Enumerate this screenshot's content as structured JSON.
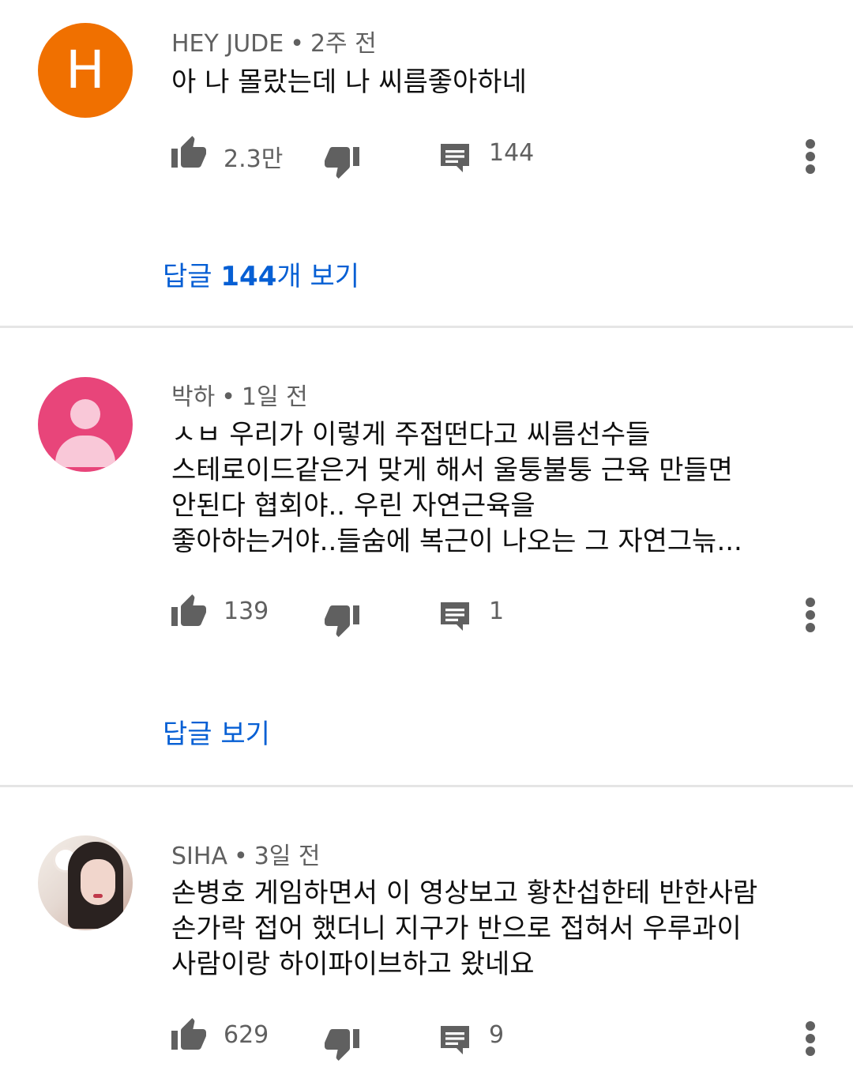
{
  "comments": [
    {
      "author": "HEY JUDE",
      "separator": "•",
      "time": "2주 전",
      "avatar_letter": "H",
      "text": "아 나 몰랐는데 나 씨름좋아하네",
      "likes": "2.3만",
      "replies_count": "144",
      "replies_link_prefix": "답글 ",
      "replies_link_bold": "144",
      "replies_link_suffix": "개 보기"
    },
    {
      "author": "박하",
      "separator": "•",
      "time": "1일 전",
      "text": "ㅅㅂ 우리가 이렇게 주접떤다고 씨름선수들\n스테로이드같은거 맞게 해서 울퉁불퉁 근육 만들면\n안된다 협회야.. 우린 자연근육을\n좋아하는거야..들숨에 복근이 나오는 그 자연그늒...",
      "likes": "139",
      "replies_count": "1",
      "replies_link": "답글 보기"
    },
    {
      "author": "SIHA",
      "separator": "•",
      "time": "3일 전",
      "text": "손병호 게임하면서 이 영상보고 황찬섭한테 반한사람\n손가락 접어 했더니 지구가 반으로 접혀서 우루과이\n사람이랑 하이파이브하고 왔네요",
      "likes": "629",
      "replies_count": "9"
    }
  ],
  "colors": {
    "link": "#065fd4",
    "meta": "#606060",
    "icon": "#606060",
    "avatar_h": "#f07000",
    "avatar_pink": "#e8457a"
  },
  "icons": [
    "thumb-up-icon",
    "thumb-down-icon",
    "reply-icon",
    "more-vert-icon"
  ]
}
